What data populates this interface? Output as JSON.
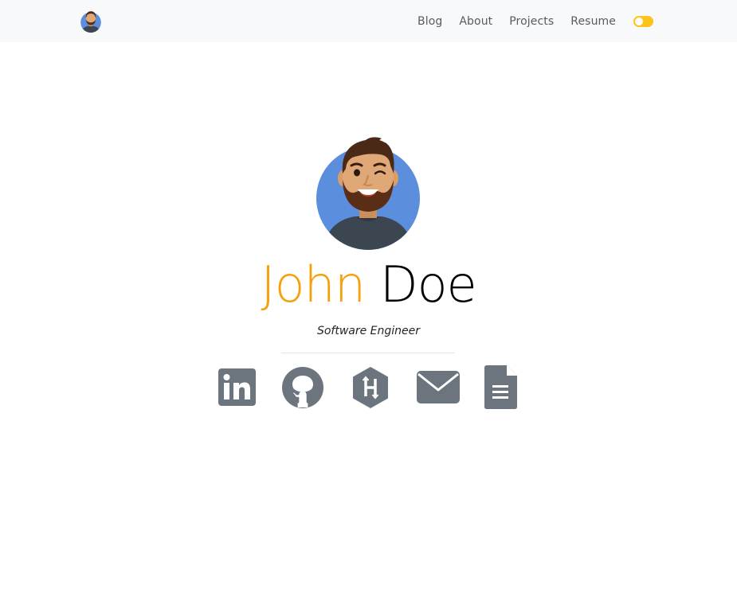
{
  "navbar": {
    "links": [
      {
        "label": "Blog"
      },
      {
        "label": "About"
      },
      {
        "label": "Projects"
      },
      {
        "label": "Resume"
      }
    ],
    "theme_toggle": {
      "state": "off"
    }
  },
  "hero": {
    "first_name": "John",
    "last_name": "Doe",
    "subtitle": "Software Engineer"
  },
  "social_links": [
    {
      "icon": "linkedin-icon"
    },
    {
      "icon": "github-icon"
    },
    {
      "icon": "hackerrank-icon"
    },
    {
      "icon": "envelope-icon"
    },
    {
      "icon": "document-icon"
    }
  ],
  "colors": {
    "accent": "#f5a00e",
    "toggle": "#fcc419",
    "icon": "#6c757d",
    "avatar_bg": "#5b8edd",
    "navbar_bg": "#f8f9fa"
  }
}
